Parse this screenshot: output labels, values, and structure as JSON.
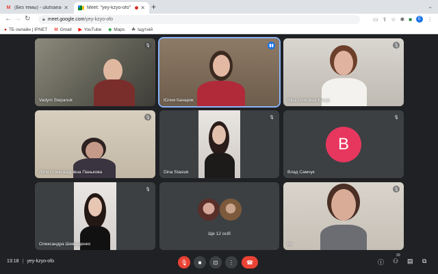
{
  "browser": {
    "tabs": [
      {
        "title": "(Без темы) - ulutnaea@gmail",
        "favicon": "M",
        "active": false
      },
      {
        "title": "Meet: \"yey-kzyo-ofo\"",
        "favicon": "meet",
        "active": true
      }
    ],
    "url_host": "meet.google.com",
    "url_path": "/yey-kzyo-ofo",
    "profile_initial": "E",
    "bookmarks": [
      {
        "label": "ТБ онлайн | IPNET",
        "icon": "tb-icon"
      },
      {
        "label": "Gmail",
        "icon": "gmail-icon"
      },
      {
        "label": "YouTube",
        "icon": "youtube-icon"
      },
      {
        "label": "Maps",
        "icon": "maps-icon"
      },
      {
        "label": "Іщутній",
        "icon": "bookmark-icon"
      }
    ]
  },
  "participants": [
    {
      "name": "Vadym Stepanuk",
      "muted": true
    },
    {
      "name": "Юлия Канарик",
      "speaking": true
    },
    {
      "name": "Віра Олесівна Качур",
      "muted": true
    },
    {
      "name": "Лілія Олександрівна Панькова",
      "muted": true
    },
    {
      "name": "Dina Stasiuk",
      "muted": true
    },
    {
      "name": "Влад Самчук",
      "muted": true,
      "avatar_letter": "B",
      "avatar_color": "#e8375f"
    },
    {
      "name": "Олександра Шевчуденко",
      "muted": true
    },
    {
      "name": "Ще 12 осіб"
    },
    {
      "name": "Ви",
      "muted": true
    }
  ],
  "meeting": {
    "time": "13:18",
    "code": "yey-kzyo-ofo",
    "participant_count": "20"
  }
}
